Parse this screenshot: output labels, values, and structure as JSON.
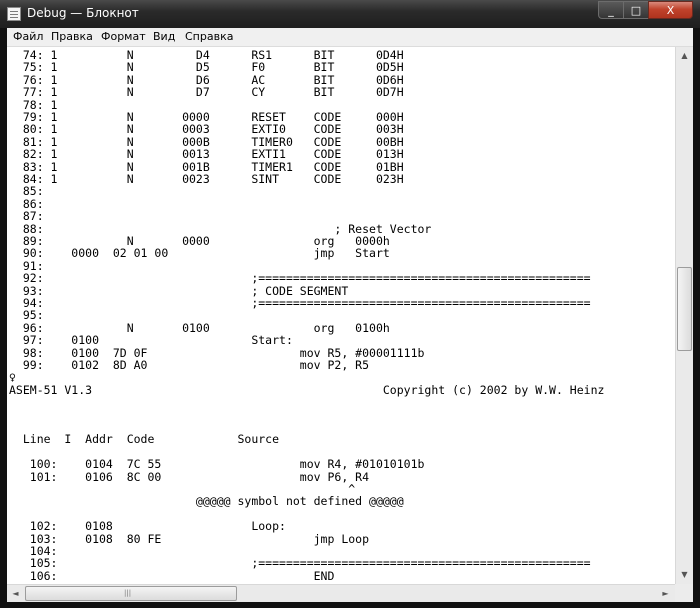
{
  "window": {
    "title": "Debug — Блокнот",
    "buttons": {
      "minimize": "_",
      "maximize": "□",
      "close": "X"
    }
  },
  "menu": [
    "Файл",
    "Правка",
    "Формат",
    "Вид",
    "Справка"
  ],
  "editor_lines": [
    "  74: 1          N         D4      RS1      BIT      0D4H",
    "  75: 1          N         D5      F0       BIT      0D5H",
    "  76: 1          N         D6      AC       BIT      0D6H",
    "  77: 1          N         D7      CY       BIT      0D7H",
    "  78: 1",
    "  79: 1          N       0000      RESET    CODE     000H",
    "  80: 1          N       0003      EXTI0    CODE     003H",
    "  81: 1          N       000B      TIMER0   CODE     00BH",
    "  82: 1          N       0013      EXTI1    CODE     013H",
    "  83: 1          N       001B      TIMER1   CODE     01BH",
    "  84: 1          N       0023      SINT     CODE     023H",
    "  85:",
    "  86:",
    "  87:",
    "  88:                                          ; Reset Vector",
    "  89:            N       0000               org   0000h",
    "  90:    0000  02 01 00                     jmp   Start",
    "  91:",
    "  92:                              ;================================================",
    "  93:                              ; CODE SEGMENT",
    "  94:                              ;================================================",
    "  95:",
    "  96:            N       0100               org   0100h",
    "  97:    0100                      Start:",
    "  98:    0100  7D 0F                      mov R5, #00001111b",
    "  99:    0102  8D A0                      mov P2, R5",
    "♀",
    "ASEM-51 V1.3                                          Copyright (c) 2002 by W.W. Heinz",
    "",
    "",
    "",
    "  Line  I  Addr  Code            Source",
    "",
    "   100:    0104  7C 55                    mov R4, #01010101b",
    "   101:    0106  8C 00                    mov P6, R4",
    "                                                 ^",
    "                           @@@@@ symbol not defined @@@@@",
    "",
    "   102:    0108                    Loop:",
    "   103:    0108  80 FE                      jmp Loop",
    "   104:",
    "   105:                            ;================================================",
    "   106:                                     END"
  ],
  "scrollbars": {
    "up_arrow": "▲",
    "down_arrow": "▼",
    "left_arrow": "◄",
    "right_arrow": "►",
    "grip": "|||"
  }
}
